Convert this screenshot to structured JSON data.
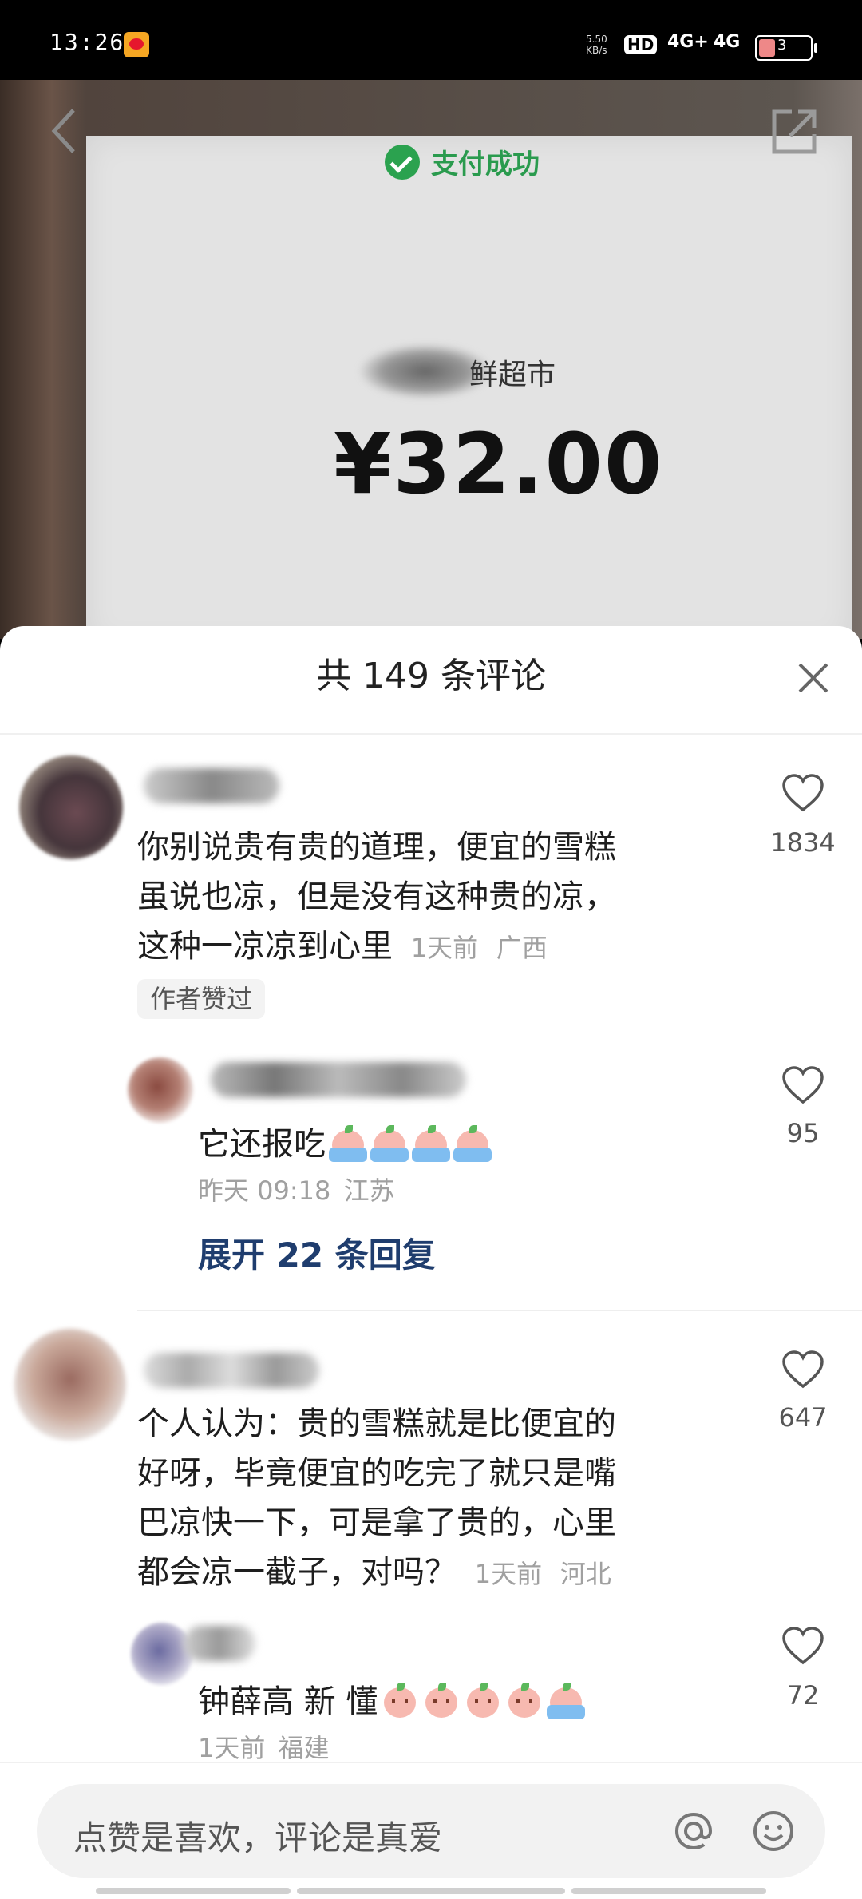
{
  "status_bar": {
    "time": "13:26",
    "net_speed_value": "5.50",
    "net_speed_unit": "KB/s",
    "hd_label": "HD",
    "sim1_label": "4G+",
    "sim2_label": "4G",
    "battery_level": "3"
  },
  "background_image": {
    "pay_status": "支付成功",
    "shop_name": "鲜超市",
    "amount": "¥32.00"
  },
  "comments_sheet": {
    "title": "共 149 条评论",
    "comments": [
      {
        "text_line1": "你别说贵有贵的道理，便宜的雪糕",
        "text_line2": "虽说也凉，但是没有这种贵的凉，",
        "text_line3": "这种一凉凉到心里",
        "time": "1天前",
        "location": "广西",
        "likes": "1834",
        "author_badge": "作者赞过"
      },
      {
        "text": "它还报吃",
        "time": "昨天 09:18",
        "location": "江苏",
        "likes": "95",
        "expand_label": "展开 22 条回复"
      },
      {
        "text_line1": "个人认为：贵的雪糕就是比便宜的",
        "text_line2": "好呀，毕竟便宜的吃完了就只是嘴",
        "text_line3": "巴凉快一下，可是拿了贵的，心里",
        "text_line4": "都会凉一截子，对吗？",
        "time": "1天前",
        "location": "河北",
        "likes": "647"
      },
      {
        "text": "钟薛高 新 懂",
        "time": "1天前",
        "location": "福建",
        "likes": "72"
      }
    ]
  },
  "input_bar": {
    "placeholder": "点赞是喜欢，评论是真爱"
  },
  "icons": {
    "back": "chevron-left-icon",
    "share": "share-icon",
    "close": "close-icon",
    "like": "heart-outline-icon",
    "mention": "at-icon",
    "emoji": "smile-icon"
  },
  "colors": {
    "expand_link": "#1f3d6e",
    "pay_green": "#2a9b4e"
  }
}
